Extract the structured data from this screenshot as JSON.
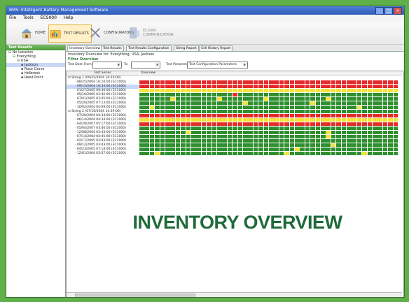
{
  "window": {
    "title": "BMS: Intelligent Battery Management Software",
    "buttons": [
      "–",
      "□",
      "×"
    ]
  },
  "menu": [
    "File",
    "Tools",
    "ECS000",
    "Help"
  ],
  "toolbar": [
    {
      "label": "HOME",
      "icon": "house-icon",
      "active": false
    },
    {
      "label": "TEST RESULTS",
      "icon": "folder-chart-icon",
      "active": true
    },
    {
      "label": "CONFIGURATORS",
      "icon": "tools-icon",
      "active": false
    },
    {
      "label": "ECS000 COMMUNICATION",
      "icon": "server-icon",
      "active": false
    }
  ],
  "left_pane": {
    "header": "Test Results",
    "tree": [
      {
        "label": "No Location",
        "indent": 0
      },
      {
        "label": "Everything",
        "indent": 1
      },
      {
        "label": "USA",
        "indent": 2
      },
      {
        "label": "Jackson",
        "indent": 3,
        "selected": true
      },
      {
        "label": "Rose Grove",
        "indent": 3
      },
      {
        "label": "Holbrook",
        "indent": 3
      },
      {
        "label": "Reed Point",
        "indent": 3
      }
    ]
  },
  "tabs": [
    "Inventory Overview",
    "Test Results",
    "Test Results Configuration",
    "String Report",
    "Cell History Report"
  ],
  "inventory_title": "Inventory Overview for: Everything, USA, Jackson",
  "filter": {
    "header": "Filter Overview",
    "date_from_label": "Test Date From:",
    "to_label": "To:",
    "param_label": "Test Parameter:",
    "param_value": "Test Configuration Parameters"
  },
  "columns": {
    "series": "Test Series",
    "overview": "Overview"
  },
  "series_rows": [
    {
      "label": "String 1 (09/25/2004 16:10:00)",
      "group": true
    },
    {
      "label": "08/25/2004 16:10:00 (EC1000)"
    },
    {
      "label": "09/15/2004 16:34:00 (EC1000)",
      "selected": true
    },
    {
      "label": "01/27/2005 09:46:00 (EC1000)"
    },
    {
      "label": "05/16/2005 03:45:00 (EC1000)"
    },
    {
      "label": "07/01/2005 03:45:00 (EC1000)"
    },
    {
      "label": "05/20/2005 07:13:00 (EC1000)"
    },
    {
      "label": "10/02/2004 04:09:00 (EC1000)"
    },
    {
      "label": "String 2 (07/16/2004 14:29:00)",
      "group": true
    },
    {
      "label": "07/30/2004 04:34:00 (EC1000)"
    },
    {
      "label": "06/14/2004 04:34:00 (EC1000)"
    },
    {
      "label": "04/29/2007 05:17:00 (EC1000)"
    },
    {
      "label": "05/04/2007 03:46:00 (EC1000)"
    },
    {
      "label": "12/08/2004 03:43:00 (EC1000)"
    },
    {
      "label": "07/14/2004 04:45:00 (EC1000)"
    },
    {
      "label": "02/17/2005 03:43:00 (EC1000)"
    },
    {
      "label": "09/12/2005 03:43:00 (EC1000)"
    },
    {
      "label": "04/23/2005 07:14:00 (EC1000)"
    },
    {
      "label": "12/01/2004 03:07:00 (EC1000)"
    }
  ],
  "colors": {
    "red": "#e52b2b",
    "green": "#2f8f2f",
    "yellow": "#f3e33b",
    "empty": "#ffffff"
  },
  "heatmap_rows": [
    "",
    "RRRRRRRRRRRRRRRRRRRRRRRRRRRRRRRRRRRRRRRRRRRRRRRRRR",
    "RRRRRRRRRRRRRRRRRRRRRRRRRRRRRRRRRRRRRRRRRRRRRRRRRR",
    "YYYYYYYYYYYYYYYYYYYYYYYYYYYYYYYYYYYYYYYYYYYYYYYYYY",
    "GGGGGGGGGGGGGGGGGGRGGGGGGGGGGGGGGGGGGGGGGGGGGGGGGG",
    "GGGGGGYGGGGGGGGYGGGGGGGGYGGGGGGGGGGGYGGGGGGGGGGGGG",
    "GGGGGGGGGGGGGGGGGGGGYGGGGGGGGGGGGYGGGGGGGGGGGGGGGG",
    "GGYGGGGGGGGGGGGGGGGGGGGGGGGGGGGGGGGGGGGGGGYGGGGGGG",
    "GGGGGGGGGGGGGGGGGGGGGGGGGGGGGGGGGGGGGGGGGGGGGGGGGG",
    "RRRRRRRRRRRRRRRRRRRRRRRRRRRRRRRRRRRRRRRRRRRRRRRRRR",
    "YYYYYYYYYYYYYYYYYYYYYYYYYYYYYYYYYYYYYYYYYYYYYYYYYY",
    "RRRRRRRRRRRRRRRRRRRRRRRRRRRRRRRRRRRRRRRRRRRRRRRRRR",
    "GGGGGGGGGGGGGGGGGGGGGGGGGGGGGGGGGGGGGGGGGGGGGGGGGG",
    "GGGGGGGGGYGGGGGGGGGGGGGGGGGGGGGGGGGGYGGGGGGGGGGGGG",
    "GGGGGGGGGGGGGGGGGGGGGGGGGGGGGGGGGGGGYGGGGGGGGGGGGG",
    "GGGGGGGGGGGGGGGGGGGGGGGGGGGGGGGGGGGGGGGGGGGGGGGGGG",
    "GGGGGGGGGGGGGGGGGGGGGGGGGGGGGGGGGGGGGYGGGGGGGGGGGG",
    "GGGGGGGGGGGGGGGGGGGGGGGGGGGGGGYGGGGGGGGGGGGGGGGGGG",
    "GGGYGGGGGGGGGGGGGGGGGGGGGGGGYGGGGGGGGGGGGGGYGGGGGG"
  ],
  "banner": "INVENTORY OVERVIEW"
}
